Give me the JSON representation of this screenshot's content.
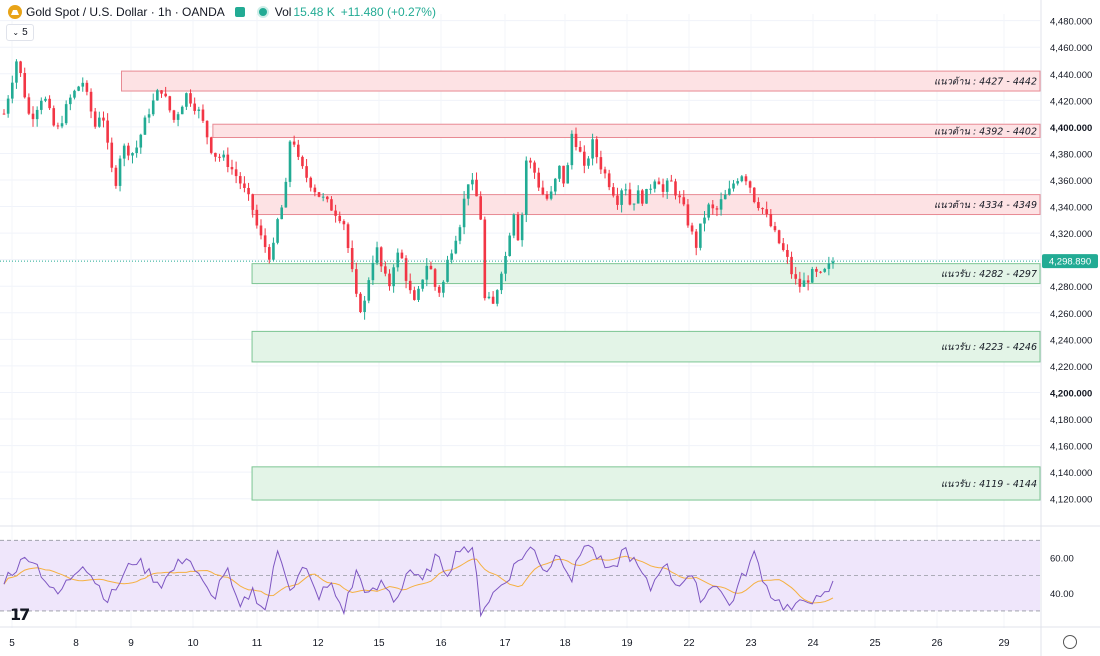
{
  "header": {
    "title": "Gold Spot / U.S. Dollar · 1h · OANDA",
    "vol_label": "Vol",
    "vol_value": "15.48 K",
    "change": "+11.480 (+0.27%)",
    "indicator_count": "5"
  },
  "colors": {
    "up": "#22ab94",
    "down": "#f23645",
    "resistance_fill": "#fde2e4",
    "resistance_border": "#e88a93",
    "support_fill": "#e3f4e7",
    "support_border": "#7cc593",
    "rsi_line": "#7e57c2",
    "rsi_ma": "#f5b041",
    "rsi_band": "#efe6fb"
  },
  "chart_data": {
    "type": "candlestick",
    "symbol": "Gold Spot / U.S. Dollar",
    "timeframe": "1h",
    "price_ylim": [
      4110,
      4485
    ],
    "y_ticks": [
      "4,480.000",
      "4,460.000",
      "4,440.000",
      "4,420.000",
      "4,400.000",
      "4,380.000",
      "4,360.000",
      "4,340.000",
      "4,320.000",
      "4,300.000",
      "4,280.000",
      "4,260.000",
      "4,240.000",
      "4,220.000",
      "4,200.000",
      "4,180.000",
      "4,160.000",
      "4,140.000",
      "4,120.000"
    ],
    "x_ticks": [
      "5",
      "8",
      "9",
      "10",
      "11",
      "12",
      "15",
      "16",
      "17",
      "18",
      "19",
      "22",
      "23",
      "24",
      "25",
      "26",
      "29"
    ],
    "current_price": "4,298.890",
    "close_path": [
      [
        0,
        4410
      ],
      [
        2,
        4452
      ],
      [
        4,
        4405
      ],
      [
        6,
        4425
      ],
      [
        8,
        4395
      ],
      [
        10,
        4420
      ],
      [
        12,
        4435
      ],
      [
        14,
        4400
      ],
      [
        15,
        4415
      ],
      [
        16,
        4380
      ],
      [
        17,
        4355
      ],
      [
        18,
        4385
      ],
      [
        20,
        4380
      ],
      [
        22,
        4410
      ],
      [
        24,
        4430
      ],
      [
        26,
        4405
      ],
      [
        28,
        4425
      ],
      [
        30,
        4410
      ],
      [
        32,
        4380
      ],
      [
        34,
        4375
      ],
      [
        36,
        4360
      ],
      [
        38,
        4340
      ],
      [
        39,
        4320
      ],
      [
        40,
        4310
      ],
      [
        41,
        4300
      ],
      [
        42,
        4332
      ],
      [
        43,
        4345
      ],
      [
        44,
        4400
      ],
      [
        45,
        4375
      ],
      [
        46,
        4365
      ],
      [
        48,
        4350
      ],
      [
        49,
        4345
      ],
      [
        50,
        4340
      ],
      [
        52,
        4330
      ],
      [
        53,
        4300
      ],
      [
        54,
        4270
      ],
      [
        55,
        4260
      ],
      [
        56,
        4290
      ],
      [
        57,
        4310
      ],
      [
        58,
        4290
      ],
      [
        59,
        4280
      ],
      [
        60,
        4305
      ],
      [
        61,
        4300
      ],
      [
        62,
        4278
      ],
      [
        63,
        4265
      ],
      [
        64,
        4285
      ],
      [
        65,
        4300
      ],
      [
        66,
        4280
      ],
      [
        67,
        4275
      ],
      [
        68,
        4300
      ],
      [
        70,
        4330
      ],
      [
        71,
        4360
      ],
      [
        72,
        4355
      ],
      [
        73,
        4335
      ],
      [
        73.5,
        4270
      ],
      [
        74,
        4270
      ],
      [
        75,
        4265
      ],
      [
        76,
        4290
      ],
      [
        77,
        4305
      ],
      [
        78,
        4340
      ],
      [
        79,
        4310
      ],
      [
        80,
        4375
      ],
      [
        81,
        4370
      ],
      [
        82,
        4355
      ],
      [
        83,
        4345
      ],
      [
        84,
        4350
      ],
      [
        85,
        4370
      ],
      [
        86,
        4355
      ],
      [
        87,
        4395
      ],
      [
        88,
        4385
      ],
      [
        89,
        4365
      ],
      [
        90,
        4390
      ],
      [
        91,
        4375
      ],
      [
        92,
        4365
      ],
      [
        93,
        4355
      ],
      [
        94,
        4345
      ],
      [
        95,
        4360
      ],
      [
        96,
        4340
      ],
      [
        97,
        4350
      ],
      [
        98,
        4345
      ],
      [
        99,
        4355
      ],
      [
        100,
        4365
      ],
      [
        101,
        4350
      ],
      [
        102,
        4360
      ],
      [
        103,
        4350
      ],
      [
        104,
        4340
      ],
      [
        105,
        4325
      ],
      [
        106,
        4310
      ],
      [
        107,
        4330
      ],
      [
        108,
        4340
      ],
      [
        109,
        4335
      ],
      [
        110,
        4345
      ],
      [
        111,
        4350
      ],
      [
        112,
        4360
      ],
      [
        113,
        4365
      ],
      [
        114,
        4360
      ],
      [
        115,
        4345
      ],
      [
        116,
        4340
      ],
      [
        117,
        4330
      ],
      [
        118,
        4320
      ],
      [
        119,
        4310
      ],
      [
        120,
        4300
      ],
      [
        121,
        4285
      ],
      [
        122,
        4280
      ],
      [
        123,
        4285
      ],
      [
        124,
        4290
      ],
      [
        125,
        4287
      ],
      [
        126,
        4292
      ],
      [
        127,
        4298.89
      ]
    ],
    "zones": [
      {
        "kind": "resistance",
        "label": "แนวต้าน : 4427 - 4442",
        "low": 4427,
        "high": 4442,
        "start_index": 18
      },
      {
        "kind": "resistance",
        "label": "แนวต้าน : 4392 - 4402",
        "low": 4392,
        "high": 4402,
        "start_index": 32
      },
      {
        "kind": "resistance",
        "label": "แนวต้าน : 4334 - 4349",
        "low": 4334,
        "high": 4349,
        "start_index": 38
      },
      {
        "kind": "support",
        "label": "แนวรับ : 4282 - 4297",
        "low": 4282,
        "high": 4297,
        "start_index": 38
      },
      {
        "kind": "support",
        "label": "แนวรับ : 4223 - 4246",
        "low": 4223,
        "high": 4246,
        "start_index": 38
      },
      {
        "kind": "support",
        "label": "แนวรับ : 4119 - 4144",
        "low": 4119,
        "high": 4144,
        "start_index": 38
      }
    ],
    "rsi": {
      "ylim": [
        26,
        73
      ],
      "band": [
        30,
        70
      ],
      "mid": 50,
      "y_ticks": [
        "60.00",
        "40.00"
      ],
      "path": [
        [
          0,
          48
        ],
        [
          4,
          62
        ],
        [
          8,
          38
        ],
        [
          12,
          58
        ],
        [
          16,
          36
        ],
        [
          20,
          60
        ],
        [
          24,
          45
        ],
        [
          28,
          62
        ],
        [
          30,
          48
        ],
        [
          32,
          36
        ],
        [
          34,
          55
        ],
        [
          36,
          30
        ],
        [
          38,
          42
        ],
        [
          40,
          30
        ],
        [
          42,
          65
        ],
        [
          44,
          42
        ],
        [
          46,
          55
        ],
        [
          48,
          38
        ],
        [
          50,
          45
        ],
        [
          52,
          30
        ],
        [
          54,
          52
        ],
        [
          56,
          38
        ],
        [
          58,
          46
        ],
        [
          60,
          35
        ],
        [
          62,
          55
        ],
        [
          64,
          45
        ],
        [
          66,
          60
        ],
        [
          68,
          52
        ],
        [
          70,
          68
        ],
        [
          72,
          62
        ],
        [
          73,
          30
        ],
        [
          75,
          40
        ],
        [
          77,
          48
        ],
        [
          79,
          60
        ],
        [
          81,
          66
        ],
        [
          83,
          52
        ],
        [
          85,
          64
        ],
        [
          87,
          48
        ],
        [
          89,
          70
        ],
        [
          91,
          60
        ],
        [
          93,
          50
        ],
        [
          95,
          66
        ],
        [
          97,
          55
        ],
        [
          99,
          42
        ],
        [
          101,
          58
        ],
        [
          103,
          45
        ],
        [
          105,
          50
        ],
        [
          107,
          36
        ],
        [
          109,
          48
        ],
        [
          111,
          32
        ],
        [
          113,
          48
        ],
        [
          115,
          62
        ],
        [
          117,
          42
        ],
        [
          119,
          34
        ],
        [
          121,
          30
        ],
        [
          123,
          38
        ],
        [
          125,
          35
        ],
        [
          127,
          45
        ]
      ]
    }
  }
}
